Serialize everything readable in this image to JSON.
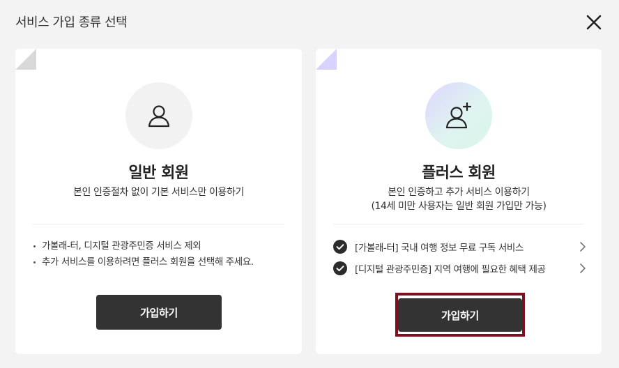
{
  "header": {
    "title": "서비스 가입 종류 선택"
  },
  "basic": {
    "title": "일반 회원",
    "description": "본인 인증절차 없이 기본 서비스만 이용하기",
    "bullets": [
      "가볼래-터, 디지털 관광주민증 서비스 제외",
      "추가 서비스를 이용하려면 플러스 회원을 선택해 주세요."
    ],
    "button_label": "가입하기"
  },
  "plus": {
    "title": "플러스 회원",
    "description_line1": "본인 인증하고 추가 서비스 이용하기",
    "description_line2": "(14세 미만 사용자는 일반 회원 가입만 가능)",
    "benefits": [
      "[가볼래-터] 국내 여행 정보 무료 구독 서비스",
      "[디지털 관광주민증] 지역 여행에 필요한 혜택 제공"
    ],
    "button_label": "가입하기"
  },
  "colors": {
    "background": "#f3f3f3",
    "button": "#333333",
    "highlight_border": "#7a1020",
    "basic_fold": "#d9d9d9",
    "plus_fold": "#d7d3ff"
  },
  "icons": {
    "close": "close-icon",
    "basic_avatar": "user-icon",
    "plus_avatar": "user-plus-icon",
    "check": "check-circle-icon",
    "chevron": "chevron-right-icon"
  }
}
